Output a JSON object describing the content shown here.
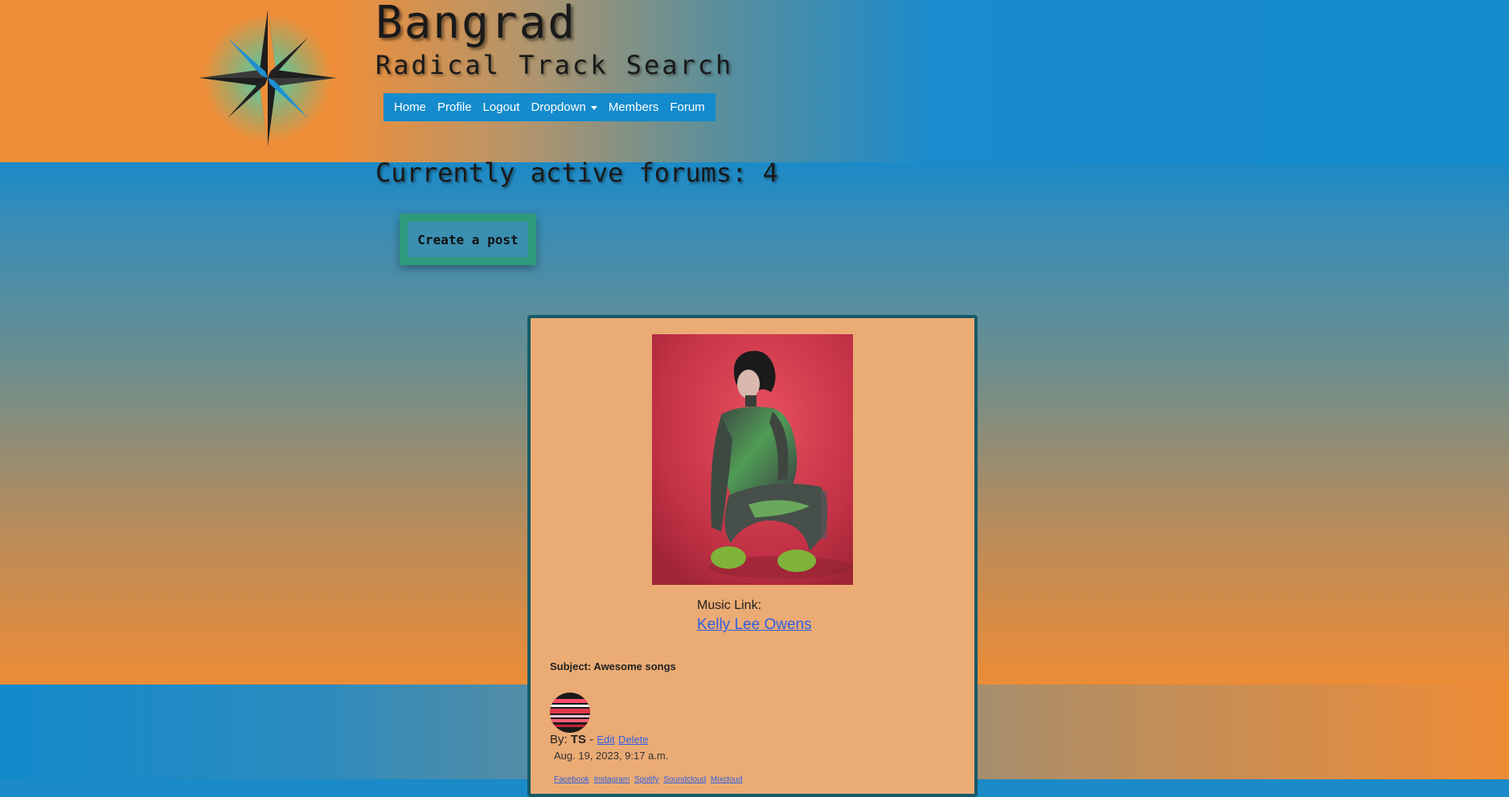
{
  "site": {
    "title": "Bangrad",
    "subtitle": "Radical Track Search"
  },
  "navbar": {
    "items": [
      {
        "label": "Home"
      },
      {
        "label": "Profile"
      },
      {
        "label": "Logout"
      },
      {
        "label": "Dropdown"
      },
      {
        "label": "Members"
      },
      {
        "label": "Forum"
      }
    ]
  },
  "forums": {
    "heading": "Currently active forums: 4",
    "create_post_label": "Create a post"
  },
  "post": {
    "music_link_label": "Music Link:",
    "music_link_text": "Kelly Lee Owens",
    "subject": "Subject: Awesome songs",
    "by_label": "By:",
    "author": "TS",
    "separator": "-",
    "edit_label": "Edit",
    "delete_label": "Delete",
    "timestamp": "Aug. 19, 2023, 9:17 a.m.",
    "social_links": [
      "Facebook",
      "Instagram",
      "Spotify",
      "Soundcloud",
      "Mixcloud"
    ]
  },
  "icons": {
    "logo": "compass-star-icon",
    "dropdown": "caret-down-icon"
  },
  "colors": {
    "orange": "#ef8e38",
    "blue": "#148bcc",
    "card": "#ebab74",
    "card_border": "#155a68",
    "button_green": "#2e9a7c",
    "link": "#2f5fe0"
  }
}
